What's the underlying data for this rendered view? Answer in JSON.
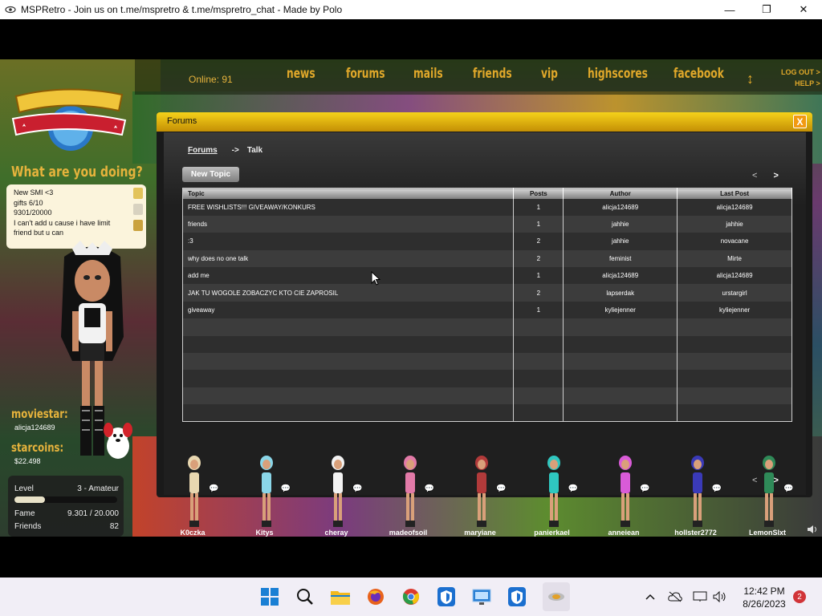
{
  "window": {
    "title": "MSPRetro - Join us on t.me/mspretro & t.me/mspretro_chat - Made by Polo",
    "minimize": "—",
    "maximize": "❐",
    "close": "✕"
  },
  "topbar": {
    "online": "Online: 91",
    "nav": [
      "news",
      "forums",
      "mails",
      "friends",
      "vip",
      "highscores",
      "facebook"
    ],
    "logout": "LOG OUT >",
    "help": "HELP >"
  },
  "sidebar": {
    "what_doing": "What are you doing?",
    "status_lines": [
      "New SMI <3",
      "gifts 6/10",
      "9301/20000",
      "I can't add u cause i have limit",
      "friend but u can"
    ],
    "moviestar_label": "moviestar:",
    "moviestar_name": "alicja124689",
    "starcoins_label": "starcoins:",
    "starcoins_value": "$22.498",
    "level_label": "Level",
    "level_value": "3 - Amateur",
    "level_progress": 0.3,
    "fame_label": "Fame",
    "fame_value": "9.301 / 20.000",
    "friends_label": "Friends",
    "friends_value": "82"
  },
  "forums": {
    "title": "Forums",
    "close": "X",
    "breadcrumb_root": "Forums",
    "breadcrumb_arrow": "->",
    "breadcrumb_current": "Talk",
    "new_topic": "New Topic",
    "prev": "<",
    "next": ">",
    "columns": [
      "Topic",
      "Posts",
      "Author",
      "Last Post"
    ],
    "rows": [
      {
        "topic": "FREE WISHLISTS!!! GIVEAWAY/KONKURS",
        "posts": "1",
        "author": "alicja124689",
        "last": "alicja124689"
      },
      {
        "topic": "friends",
        "posts": "1",
        "author": "jahhie",
        "last": "jahhie"
      },
      {
        "topic": ":3",
        "posts": "2",
        "author": "jahhie",
        "last": "novacane"
      },
      {
        "topic": "why does no one talk",
        "posts": "2",
        "author": "feminist",
        "last": "Mirte"
      },
      {
        "topic": "add me",
        "posts": "1",
        "author": "alicja124689",
        "last": "alicja124689"
      },
      {
        "topic": "JAK TU WOGOLE ZOBACZYC KTO CIE ZAPROSIL",
        "posts": "2",
        "author": "lapserdak",
        "last": "urstargirl"
      },
      {
        "topic": "giveaway",
        "posts": "1",
        "author": "kyliejenner",
        "last": "kyliejenner"
      },
      {
        "topic": "",
        "posts": "",
        "author": "",
        "last": ""
      },
      {
        "topic": "",
        "posts": "",
        "author": "",
        "last": ""
      },
      {
        "topic": "",
        "posts": "",
        "author": "",
        "last": ""
      },
      {
        "topic": "",
        "posts": "",
        "author": "",
        "last": ""
      },
      {
        "topic": "",
        "posts": "",
        "author": "",
        "last": ""
      },
      {
        "topic": "",
        "posts": "",
        "author": "",
        "last": ""
      }
    ]
  },
  "friends": [
    {
      "name": "K0czka",
      "color": "#e8d7b0"
    },
    {
      "name": "Kitys",
      "color": "#8ad6e8"
    },
    {
      "name": "cheray",
      "color": "#f2f2f2"
    },
    {
      "name": "madeofsoil",
      "color": "#e27aa8"
    },
    {
      "name": "maryiane",
      "color": "#b13a3a"
    },
    {
      "name": "panierkael",
      "color": "#2fc7c0"
    },
    {
      "name": "anneiean",
      "color": "#d95bd8"
    },
    {
      "name": "hollster2772",
      "color": "#3a3ab8"
    },
    {
      "name": "LemonSlxt",
      "color": "#2f8a58"
    }
  ],
  "taskbar": {
    "time": "12:42 PM",
    "date": "8/26/2023",
    "notifications": "2"
  }
}
